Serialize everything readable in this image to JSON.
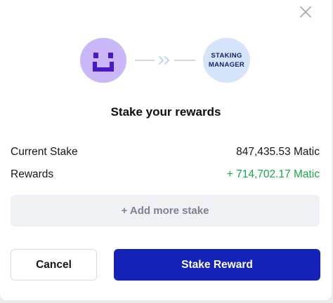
{
  "dialog": {
    "title": "Stake your rewards",
    "flow": {
      "manager_label": "STAKING\nMANAGER"
    },
    "rows": {
      "current_stake": {
        "label": "Current Stake",
        "value": "847,435.53 Matic"
      },
      "rewards": {
        "label": "Rewards",
        "value": "+ 714,702.17 Matic"
      }
    },
    "add_more_label": "+ Add more stake",
    "cancel_label": "Cancel",
    "confirm_label": "Stake Reward"
  },
  "icons": {
    "close": "close-icon",
    "avatar": "pixel-smiley-avatar",
    "connector": "double-chevron-right"
  },
  "colors": {
    "primary": "#1422b7",
    "reward_green": "#17a947",
    "avatar_bg": "#c9b7f8",
    "avatar_fg": "#4a18c4",
    "manager_bg": "#d6e4fb",
    "manager_text": "#14236b",
    "add_more_bg": "#eff1f5"
  }
}
